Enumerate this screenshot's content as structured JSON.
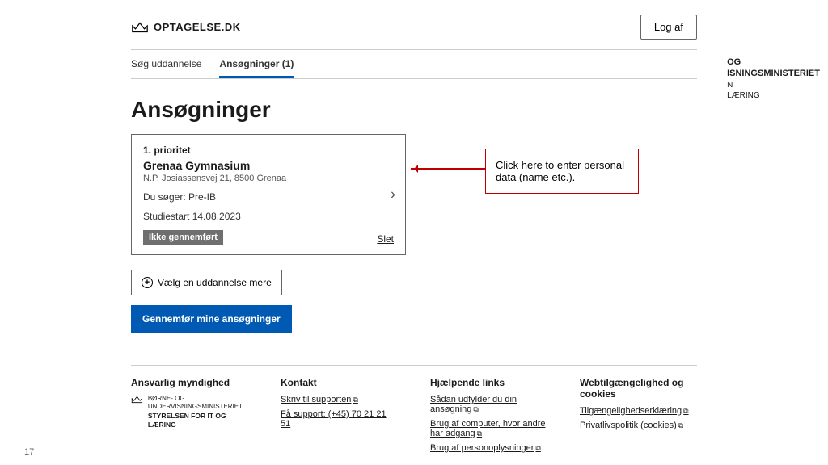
{
  "header": {
    "site_name": "OPTAGELSE.DK",
    "logout_label": "Log af"
  },
  "tabs": {
    "search": "Søg uddannelse",
    "applications": "Ansøgninger (1)"
  },
  "page_title": "Ansøgninger",
  "application": {
    "priority": "1. prioritet",
    "school_name": "Grenaa Gymnasium",
    "address": "N.P. Josiassensvej 21, 8500 Grenaa",
    "program_label": "Du søger: Pre-IB",
    "start_label": "Studiestart 14.08.2023",
    "status_badge": "Ikke gennemført",
    "delete_label": "Slet"
  },
  "buttons": {
    "add_more": "Vælg en uddannelse mere",
    "submit": "Gennemfør mine ansøgninger"
  },
  "footer": {
    "col1": {
      "heading": "Ansvarlig myndighed",
      "line1": "BØRNE- OG",
      "line2": "UNDERVISNINGSMINISTERIET",
      "line3": "STYRELSEN FOR IT OG LÆRING"
    },
    "col2": {
      "heading": "Kontakt",
      "link1": "Skriv til supporten",
      "link2": "Få support: (+45) 70 21 21 51"
    },
    "col3": {
      "heading": "Hjælpende links",
      "link1": "Sådan udfylder du din ansøgning",
      "link2": "Brug af computer, hvor andre har adgang",
      "link3": "Brug af personoplysninger"
    },
    "col4": {
      "heading": "Webtilgængelighed og cookies",
      "link1": "Tilgængelighedserklæring",
      "link2": "Privatlivspolitik (cookies)"
    }
  },
  "annotation": {
    "text": "Click here to enter personal data (name etc.)."
  },
  "ministry": {
    "line1": "OG",
    "line2": "ISNINGSMINISTERIET",
    "line3": "N",
    "line4": "LÆRING"
  },
  "page_number": "17"
}
